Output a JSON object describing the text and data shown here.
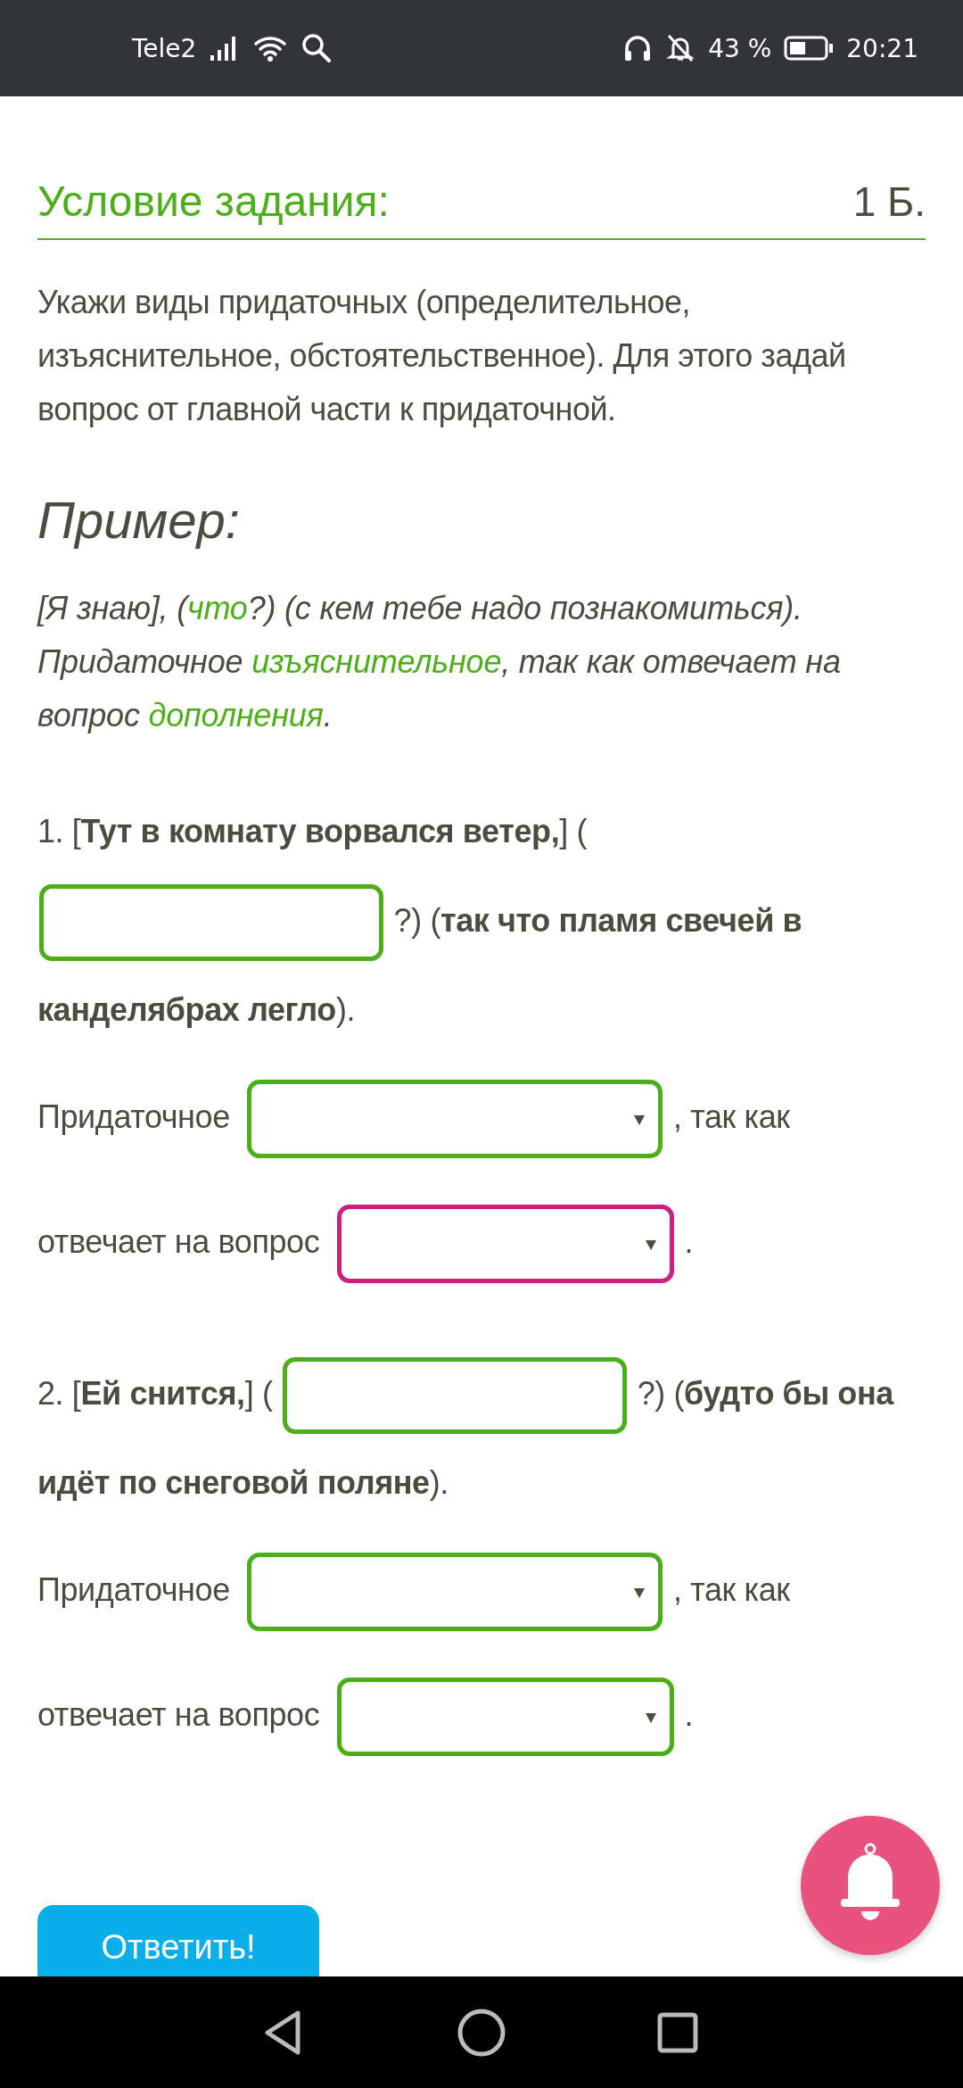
{
  "status_bar": {
    "carrier": "Tele2",
    "battery": "43 %",
    "time": "20:21"
  },
  "task": {
    "title": "Условие задания:",
    "points": "1 Б.",
    "text": "Укажи виды придаточных (определительное, изъяснительное, обстоятельственное). Для этого задай вопрос от главной части к придаточной."
  },
  "example": {
    "heading": "Пример:",
    "runs": [
      {
        "text": "[Я знаю], (",
        "highlight": false
      },
      {
        "text": "что",
        "highlight": true
      },
      {
        "text": "?) (с кем тебе надо познакомиться). Придаточное ",
        "highlight": false
      },
      {
        "text": "изъяснительное",
        "highlight": true
      },
      {
        "text": ", так как отвечает на вопрос ",
        "highlight": false
      },
      {
        "text": "дополнения",
        "highlight": true
      },
      {
        "text": ".",
        "highlight": false
      }
    ]
  },
  "exercises": [
    {
      "sentence": [
        {
          "kind": "text",
          "text": "1. [**Тут в комнату ворвался ветер,**] ("
        },
        {
          "kind": "input",
          "color": "#4caf1a"
        },
        {
          "kind": "text",
          "text": "?) (**так что пламя свечей в**"
        },
        {
          "kind": "text",
          "text": "**канделябрах легло**)."
        }
      ],
      "answer": [
        {
          "kind": "text",
          "text": "Придаточное"
        },
        {
          "kind": "select",
          "color": "#4caf1a"
        },
        {
          "kind": "text",
          "text": ", так как"
        },
        {
          "kind": "text",
          "text": "отвечает на вопрос"
        },
        {
          "kind": "select",
          "color": "#cc1f7f"
        },
        {
          "kind": "text",
          "text": "."
        }
      ]
    },
    {
      "sentence": [
        {
          "kind": "text",
          "text": "2. [**Ей снится,**] ("
        },
        {
          "kind": "input",
          "color": "#4caf1a"
        },
        {
          "kind": "text",
          "text": "?) (**будто бы она**"
        },
        {
          "kind": "text",
          "text": "**идёт по снеговой поляне**)."
        }
      ],
      "answer": [
        {
          "kind": "text",
          "text": "Придаточное"
        },
        {
          "kind": "select",
          "color": "#4caf1a"
        },
        {
          "kind": "text",
          "text": ", так как"
        },
        {
          "kind": "text",
          "text": "отвечает на вопрос"
        },
        {
          "kind": "select",
          "color": "#4caf1a"
        },
        {
          "kind": "text",
          "text": "."
        }
      ]
    }
  ],
  "submit_button": "Ответить!"
}
